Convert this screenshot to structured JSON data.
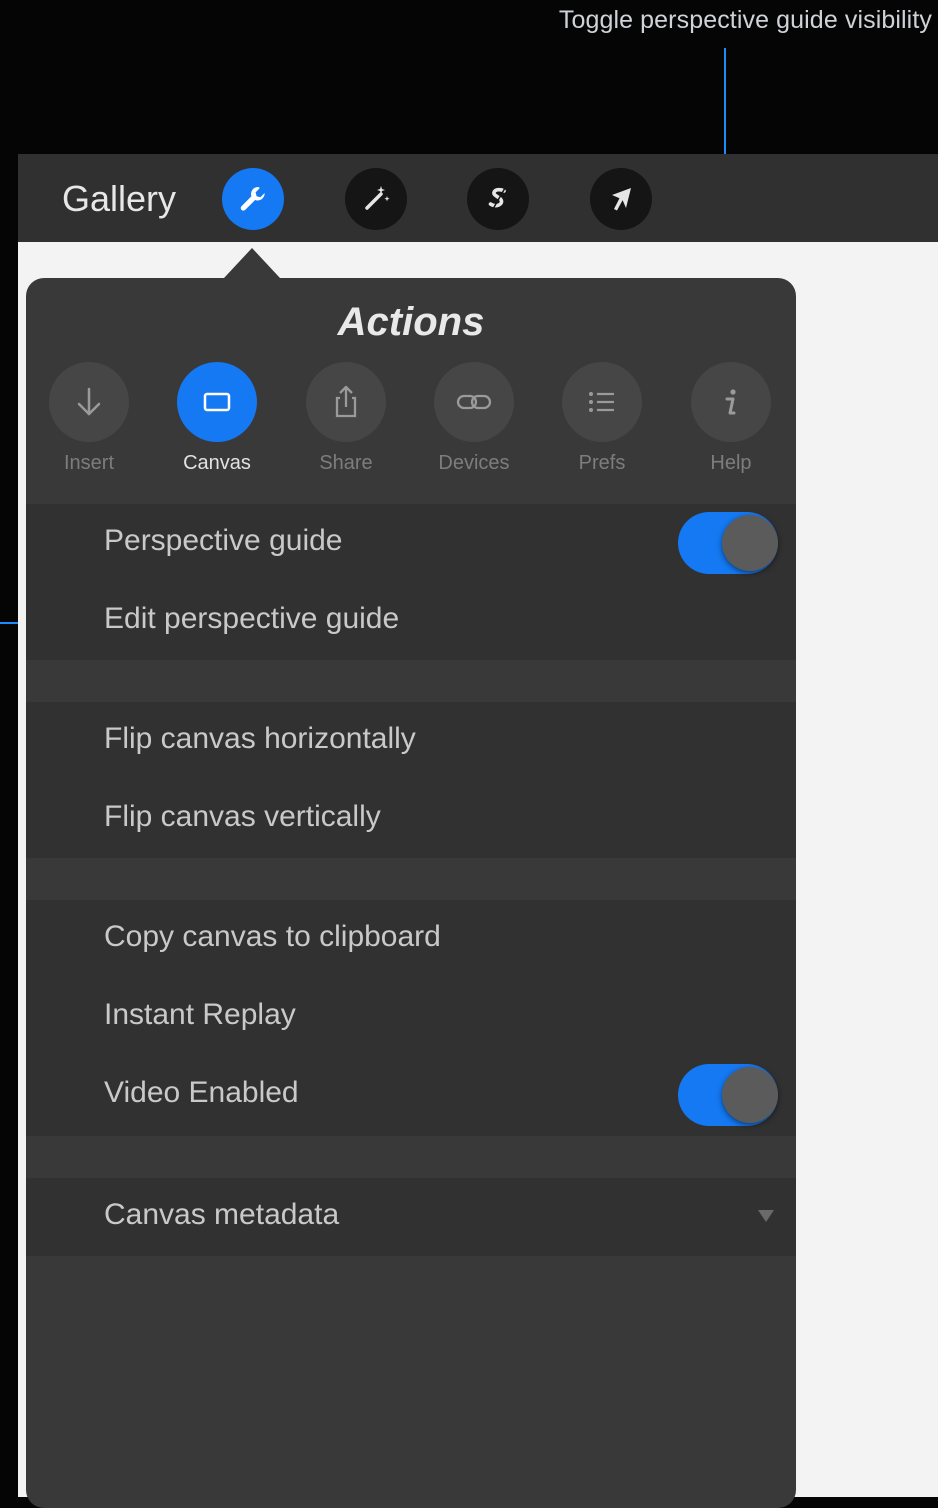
{
  "annotations": {
    "toggle_label": "Toggle perspective guide visibility"
  },
  "toolbar": {
    "gallery_label": "Gallery",
    "tools": [
      {
        "name": "actions-wrench",
        "active": true
      },
      {
        "name": "adjustments-wand",
        "active": false
      },
      {
        "name": "selection-s",
        "active": false
      },
      {
        "name": "transform-arrow",
        "active": false
      }
    ]
  },
  "panel": {
    "title": "Actions",
    "tabs": [
      {
        "label": "Insert",
        "icon": "down-arrow-icon",
        "active": false
      },
      {
        "label": "Canvas",
        "icon": "canvas-rectangle-icon",
        "active": true
      },
      {
        "label": "Share",
        "icon": "share-icon",
        "active": false
      },
      {
        "label": "Devices",
        "icon": "link-icon",
        "active": false
      },
      {
        "label": "Prefs",
        "icon": "list-icon",
        "active": false
      },
      {
        "label": "Help",
        "icon": "info-icon",
        "active": false
      }
    ],
    "groups": [
      {
        "items": [
          {
            "label": "Perspective guide",
            "toggle": true,
            "on": true
          },
          {
            "label": "Edit perspective guide"
          }
        ]
      },
      {
        "items": [
          {
            "label": "Flip canvas horizontally"
          },
          {
            "label": "Flip canvas vertically"
          }
        ]
      },
      {
        "items": [
          {
            "label": "Copy canvas to clipboard"
          },
          {
            "label": "Instant Replay"
          },
          {
            "label": "Video Enabled",
            "toggle": true,
            "on": true
          }
        ]
      },
      {
        "items": [
          {
            "label": "Canvas metadata",
            "dropdown": true
          }
        ]
      }
    ]
  },
  "colors": {
    "accent": "#1479f3",
    "panel_bg": "#393939",
    "group_bg": "#313131",
    "toolbar_bg": "#303030",
    "annotation": "#1a8cff"
  }
}
